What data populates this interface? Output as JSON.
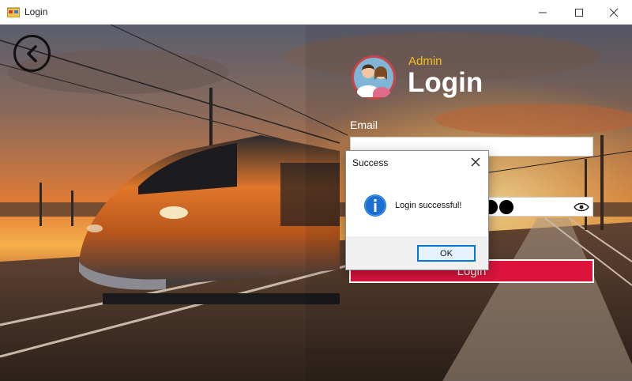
{
  "window": {
    "title": "Login"
  },
  "header": {
    "role": "Admin",
    "title": "Login"
  },
  "form": {
    "email_label": "Email",
    "email_value": "",
    "password_value": "●●●●●●●●",
    "login_button": "Login"
  },
  "dialog": {
    "title": "Success",
    "message": "Login successful!",
    "ok_label": "OK"
  },
  "colors": {
    "accent": "#dc143c",
    "role_text": "#f4c21b",
    "dialog_button_border": "#0078d7"
  },
  "icons": [
    "app-icon",
    "minimize-icon",
    "maximize-icon",
    "close-icon",
    "back-arrow-icon",
    "admin-avatar-icon",
    "eye-icon",
    "info-icon"
  ]
}
